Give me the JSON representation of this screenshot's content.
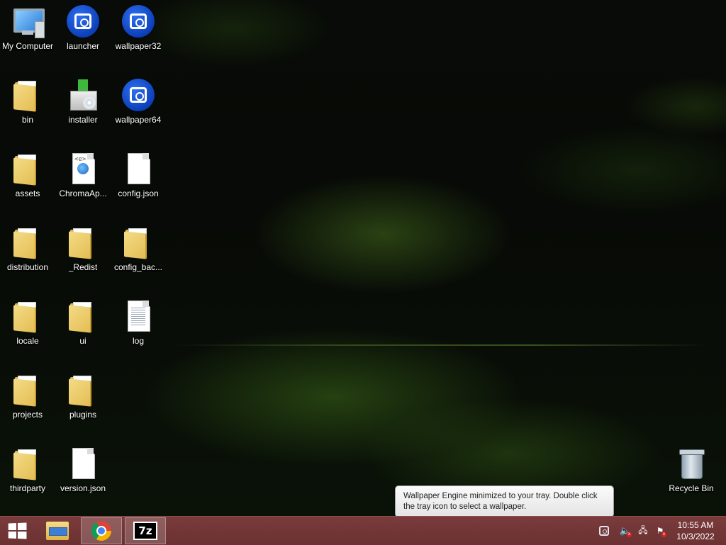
{
  "desktop": {
    "icons": [
      {
        "label": "My Computer"
      },
      {
        "label": "launcher"
      },
      {
        "label": "wallpaper32"
      },
      {
        "label": "bin"
      },
      {
        "label": "installer"
      },
      {
        "label": "wallpaper64"
      },
      {
        "label": "assets"
      },
      {
        "label": "ChromaAp..."
      },
      {
        "label": "config.json"
      },
      {
        "label": "distribution"
      },
      {
        "label": "_Redist"
      },
      {
        "label": "config_bac..."
      },
      {
        "label": "locale"
      },
      {
        "label": "ui"
      },
      {
        "label": "log"
      },
      {
        "label": "projects"
      },
      {
        "label": "plugins"
      },
      {
        "label": "thirdparty"
      },
      {
        "label": "version.json"
      },
      {
        "label": "Recycle Bin"
      }
    ]
  },
  "notification": {
    "message": "Wallpaper Engine minimized to your tray. Double click the tray icon to select a wallpaper."
  },
  "taskbar": {
    "apps": [
      {
        "icon": "file-explorer-icon"
      },
      {
        "icon": "chrome-icon"
      },
      {
        "icon": "7zip-icon",
        "text": "7z"
      }
    ],
    "tray": {
      "icons": [
        "wallpaper-engine-tray-icon",
        "volume-muted-icon",
        "network-disconnected-icon",
        "action-center-flag-icon"
      ]
    },
    "clock": {
      "time": "10:55 AM",
      "date": "10/3/2022"
    }
  },
  "colors": {
    "taskbar": "#6b3131",
    "accent_green": "#3a6a1c"
  }
}
